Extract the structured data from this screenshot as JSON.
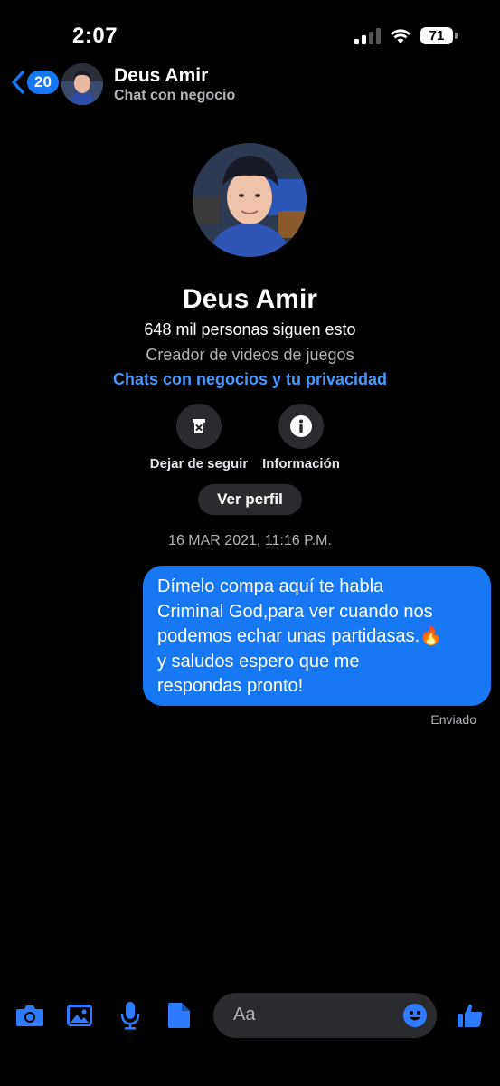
{
  "status_bar": {
    "time": "2:07",
    "battery": "71"
  },
  "header": {
    "back_count": "20",
    "name": "Deus Amir",
    "subtitle": "Chat con negocio"
  },
  "profile": {
    "name": "Deus Amir",
    "followers": "648 mil personas siguen esto",
    "category": "Creador de videos de juegos",
    "privacy_link": "Chats con negocios y tu privacidad",
    "actions": [
      {
        "label": "Dejar de seguir",
        "icon": "unfollow-icon"
      },
      {
        "label": "Información",
        "icon": "info-icon"
      }
    ],
    "view_profile": "Ver perfil"
  },
  "conversation": {
    "timestamp": "16 MAR 2021, 11:16 P.M.",
    "messages": [
      {
        "lines": [
          "Dímelo compa aquí te habla",
          "Criminal God,para ver cuando nos",
          "podemos echar unas partidasas.🔥",
          "y saludos espero que me",
          "respondas pronto!"
        ],
        "status": "Enviado"
      }
    ]
  },
  "composer": {
    "placeholder": "Aa",
    "icons": [
      "camera-icon",
      "gallery-icon",
      "microphone-icon",
      "file-icon",
      "emoji-icon",
      "like-icon"
    ]
  },
  "colors": {
    "accent": "#1877f2",
    "link": "#4599ff",
    "surface": "#2a2b2f",
    "muted": "#b0b3b8"
  }
}
